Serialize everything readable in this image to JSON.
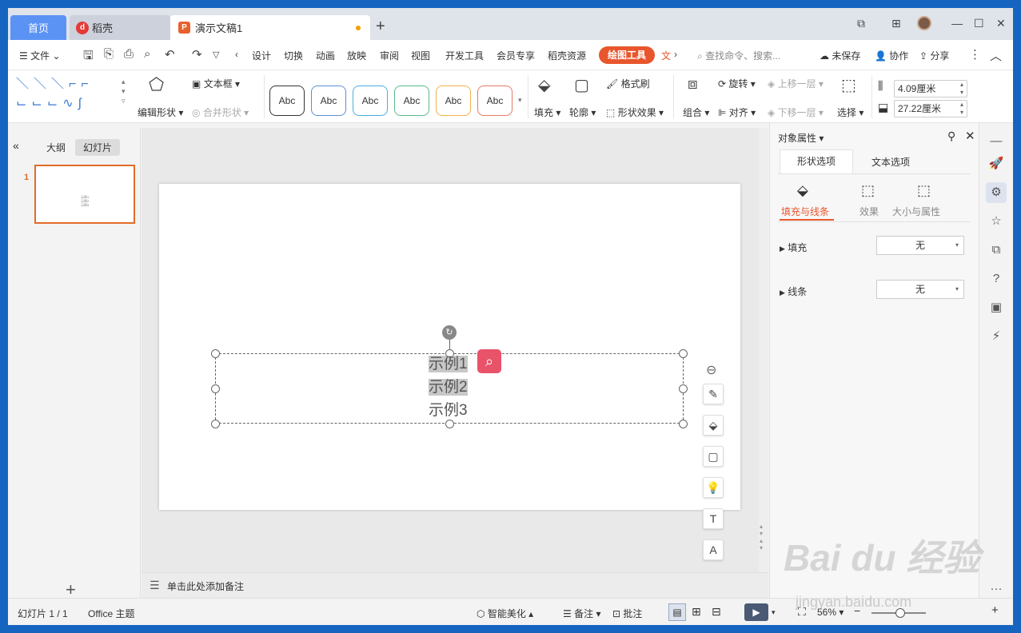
{
  "tabs": {
    "home": "首页",
    "daoke": "稻壳",
    "doc": "演示文稿1",
    "new_tab": "+"
  },
  "menu": {
    "file": "文件",
    "items": [
      "设计",
      "切换",
      "动画",
      "放映",
      "审阅",
      "视图",
      "开发工具",
      "会员专享",
      "稻壳资源"
    ],
    "active": "绘图工具",
    "text_tool": "文",
    "search_placeholder": "查找命令、搜索...",
    "unsaved": "未保存",
    "collab": "协作",
    "share": "分享"
  },
  "ribbon": {
    "edit_shape": "编辑形状",
    "text_box": "文本框",
    "merge_shape": "合并形状",
    "abc_label": "Abc",
    "abc_colors": [
      "#333333",
      "#5b8fd6",
      "#4aaede",
      "#59b98a",
      "#f0b24a",
      "#e57a66"
    ],
    "fill": "填充",
    "outline": "轮廓",
    "format_painter": "格式刷",
    "shape_effect": "形状效果",
    "group": "组合",
    "rotate": "旋转",
    "align": "对齐",
    "bring_forward": "上移一层",
    "send_backward": "下移一层",
    "select": "选择",
    "height": "4.09厘米",
    "width": "27.22厘米"
  },
  "left_panel": {
    "outline_tab": "大纲",
    "slides_tab": "幻灯片",
    "slide_number": "1",
    "add": "+"
  },
  "slide": {
    "lines": [
      "示例1",
      "示例2",
      "示例3"
    ]
  },
  "notes": {
    "placeholder": "单击此处添加备注"
  },
  "right_panel": {
    "title": "对象属性",
    "tab_shape": "形状选项",
    "tab_text": "文本选项",
    "sub_fill_line": "填充与线条",
    "sub_effect": "效果",
    "sub_size": "大小与属性",
    "fill_label": "填充",
    "fill_value": "无",
    "line_label": "线条",
    "line_value": "无"
  },
  "status": {
    "slide_info": "幻灯片 1 / 1",
    "theme": "Office 主题",
    "beautify": "智能美化",
    "notes": "备注",
    "comments": "批注",
    "zoom": "56%"
  },
  "watermark": {
    "brand": "Bai du 经验",
    "url": "jingyan.baidu.com"
  }
}
